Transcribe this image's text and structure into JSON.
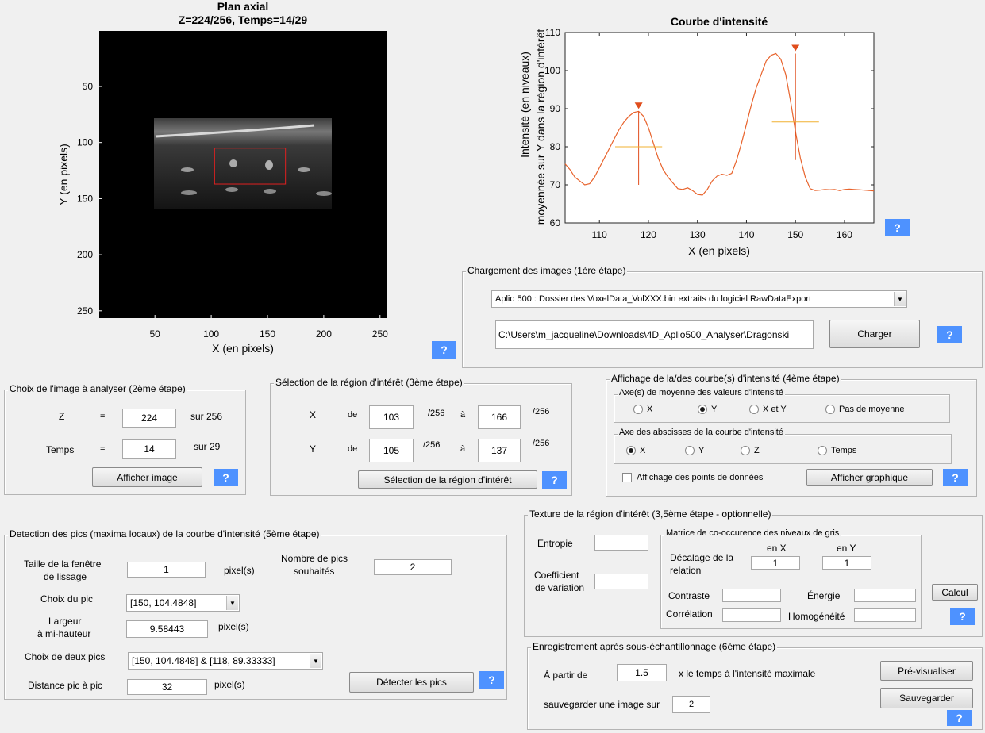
{
  "axial_plot": {
    "title": "Plan axial",
    "subtitle": "Z=224/256, Temps=14/29",
    "xlabel": "X (en pixels)",
    "ylabel": "Y (en pixels)",
    "xticks": [
      "50",
      "100",
      "150",
      "200",
      "250"
    ],
    "yticks": [
      "50",
      "100",
      "150",
      "200",
      "250"
    ],
    "roi": {
      "x_from": 103,
      "x_to": 166,
      "y_from": 105,
      "y_to": 137
    },
    "roi_color": "#e02020"
  },
  "chart_data": {
    "type": "line",
    "title": "Courbe d'intensité",
    "xlabel": "X (en pixels)",
    "ylabel_line1": "Intensité (en niveaux)",
    "ylabel_line2": "moyennée sur Y dans la région d'intérêt",
    "xlim": [
      103,
      166
    ],
    "ylim": [
      60,
      110
    ],
    "xticks": [
      "110",
      "120",
      "130",
      "140",
      "150",
      "160"
    ],
    "yticks": [
      "60",
      "70",
      "80",
      "90",
      "100",
      "110"
    ],
    "series": [
      {
        "color": "#e8632c",
        "x": [
          103,
          104,
          105,
          106,
          107,
          108,
          109,
          110,
          111,
          112,
          113,
          114,
          115,
          116,
          117,
          118,
          119,
          120,
          121,
          122,
          123,
          124,
          125,
          126,
          127,
          128,
          129,
          130,
          131,
          132,
          133,
          134,
          135,
          136,
          137,
          138,
          139,
          140,
          141,
          142,
          143,
          144,
          145,
          146,
          147,
          148,
          149,
          150,
          151,
          152,
          153,
          154,
          155,
          156,
          157,
          158,
          159,
          160,
          161,
          162,
          163,
          164,
          165,
          166
        ],
        "y": [
          75.5,
          74,
          72,
          71,
          70,
          70.3,
          72,
          74.5,
          77,
          79.5,
          82,
          84.5,
          86.5,
          88,
          89,
          89.3,
          88,
          85,
          81,
          77,
          74,
          72,
          70.5,
          69,
          68.8,
          69.2,
          68.5,
          67.5,
          67.3,
          68.8,
          71,
          72.3,
          72.8,
          72.5,
          73,
          76.5,
          81,
          86,
          91,
          95.5,
          99,
          102.5,
          104,
          104.5,
          103,
          99,
          92,
          84,
          77,
          72,
          69,
          68.5,
          68.6,
          68.8,
          68.7,
          68.8,
          68.5,
          68.8,
          68.9,
          68.8,
          68.7,
          68.6,
          68.5,
          68.4
        ]
      }
    ],
    "peaks": [
      {
        "x": 118,
        "y": 89.33333,
        "half_width": 9.58443,
        "half_height": 80
      },
      {
        "x": 150,
        "y": 104.4848,
        "half_width": 9.58443,
        "half_height": 86.5
      }
    ],
    "peak_marker_color": "#e04d1c",
    "half_line_color": "#f0b030"
  },
  "chargement": {
    "title": "Chargement des images (1ère étape)",
    "dropdown": "Aplio 500 : Dossier des VoxelData_VolXXX.bin extraits du logiciel RawDataExport",
    "path": "C:\\Users\\m_jacqueline\\Downloads\\4D_Aplio500_Analyser\\Dragonski",
    "button": "Charger"
  },
  "choix": {
    "title": "Choix de l'image à analyser (2ème étape)",
    "z_label": "Z",
    "eq": "=",
    "z_value": "224",
    "z_suffix": "sur 256",
    "t_label": "Temps",
    "t_value": "14",
    "t_suffix": "sur 29",
    "button": "Afficher image"
  },
  "selection": {
    "title": "Sélection de la région d'intérêt (3ème étape)",
    "x_label": "X",
    "y_label": "Y",
    "de": "de",
    "a": "à",
    "unit": "/256",
    "x_from": "103",
    "x_to": "166",
    "y_from": "105",
    "y_to": "137",
    "button": "Sélection de la région d'intérêt"
  },
  "affichage": {
    "title": "Affichage de la/des courbe(s) d'intensité (4ème étape)",
    "axe_moyenne_title": "Axe(s) de moyenne des valeurs d'intensité",
    "axe_moyenne_options": [
      "X",
      "Y",
      "X et Y",
      "Pas de moyenne"
    ],
    "axe_moyenne_selected": 1,
    "axe_abscisse_title": "Axe des abscisses de la courbe d'intensité",
    "axe_abscisse_options": [
      "X",
      "Y",
      "Z",
      "Temps"
    ],
    "axe_abscisse_selected": 0,
    "checkbox": "Affichage des points de données",
    "button": "Afficher graphique"
  },
  "detection": {
    "title": "Detection des pics (maxima locaux) de la courbe d'intensité (5ème étape)",
    "taille_label_1": "Taille de la fenêtre",
    "taille_label_2": "de lissage",
    "taille_value": "1",
    "pixels_unit": "pixel(s)",
    "nb_label_1": "Nombre de pics",
    "nb_label_2": "souhaités",
    "nb_value": "2",
    "choix_pic_label": "Choix du pic",
    "choix_pic_value": "[150, 104.4848]",
    "largeur_label_1": "Largeur",
    "largeur_label_2": "à mi-hauteur",
    "largeur_value": "9.58443",
    "choix_deux_label": "Choix de deux pics",
    "choix_deux_value": "[150, 104.4848] & [118, 89.33333]",
    "distance_label": "Distance pic à pic",
    "distance_value": "32",
    "button": "Détecter les pics"
  },
  "texture": {
    "title": "Texture de la région d'intérêt (3,5ème étape - optionnelle)",
    "entropie": "Entropie",
    "coef_1": "Coefficient",
    "coef_2": "de variation",
    "matrice_title": "Matrice de co-occurence des niveaux de gris",
    "en_x": "en X",
    "en_y": "en Y",
    "decalage_1": "Décalage de la",
    "decalage_2": "relation",
    "dec_x": "1",
    "dec_y": "1",
    "contraste": "Contraste",
    "energie": "Énergie",
    "correlation": "Corrélation",
    "homogeneite": "Homogénéité",
    "button": "Calcul"
  },
  "enregistrement": {
    "title": "Enregistrement après sous-échantillonnage (6ème étape)",
    "a_partir": "À partir de",
    "factor": "1.5",
    "suffix": "x le temps à l'intensité maximale",
    "sauver_label": "sauvegarder une image sur",
    "sauver_value": "2",
    "preview_button": "Pré-visualiser",
    "save_button": "Sauvegarder"
  },
  "help_label": "?"
}
